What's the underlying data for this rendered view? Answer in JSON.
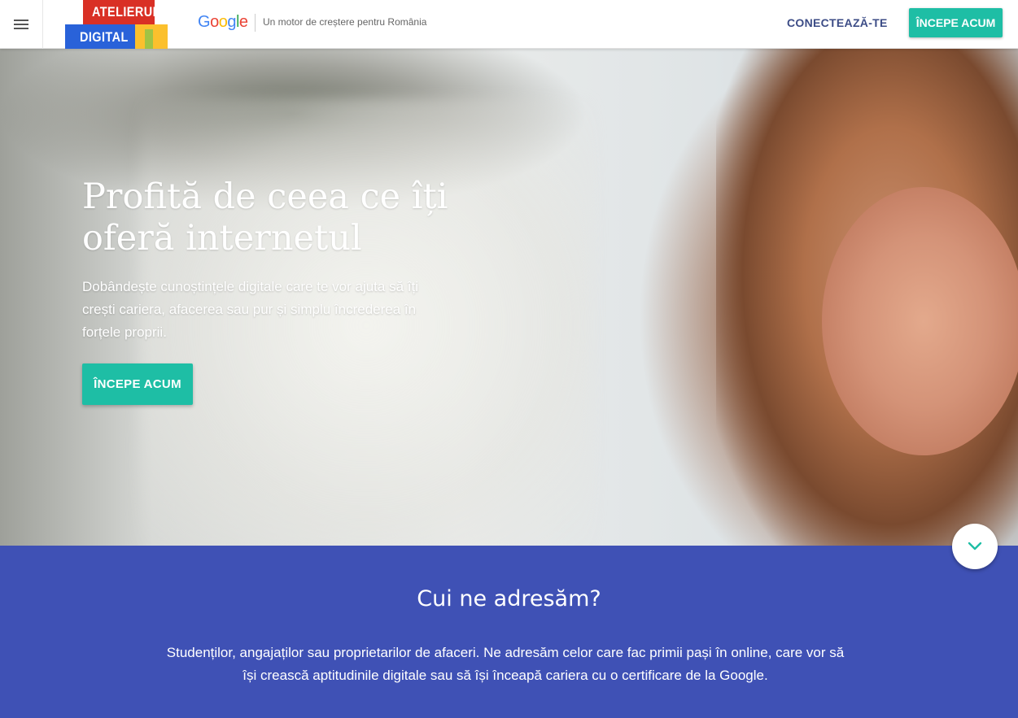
{
  "header": {
    "logo": {
      "line1": "ATELIERUL",
      "line2": "DIGITAL"
    },
    "brand_letters": [
      "G",
      "o",
      "o",
      "g",
      "l",
      "e"
    ],
    "tagline": "Un motor de creștere pentru România",
    "connect_label": "CONECTEAZĂ-TE",
    "start_label": "ÎNCEPE ACUM"
  },
  "hero": {
    "title": "Profită de ceea ce îți oferă internetul",
    "description": "Dobândește cunoștințele digitale care te vor ajuta să îți crești cariera, afacerea sau pur și simplu încrederea în forțele proprii.",
    "cta_label": "ÎNCEPE ACUM"
  },
  "audience": {
    "title": "Cui ne adresăm?",
    "text": "Studenților, angajaților sau proprietarilor de afaceri. Ne adresăm celor care fac primii pași în online, care vor să își crească aptitudinile digitale sau să își înceapă cariera cu o certificare de la Google."
  },
  "icons": {
    "menu": "hamburger-menu-icon",
    "scroll": "chevron-down-icon"
  },
  "colors": {
    "accent": "#1ebea5",
    "section_bg": "#3f51b5",
    "connect_text": "#3c4c86"
  }
}
